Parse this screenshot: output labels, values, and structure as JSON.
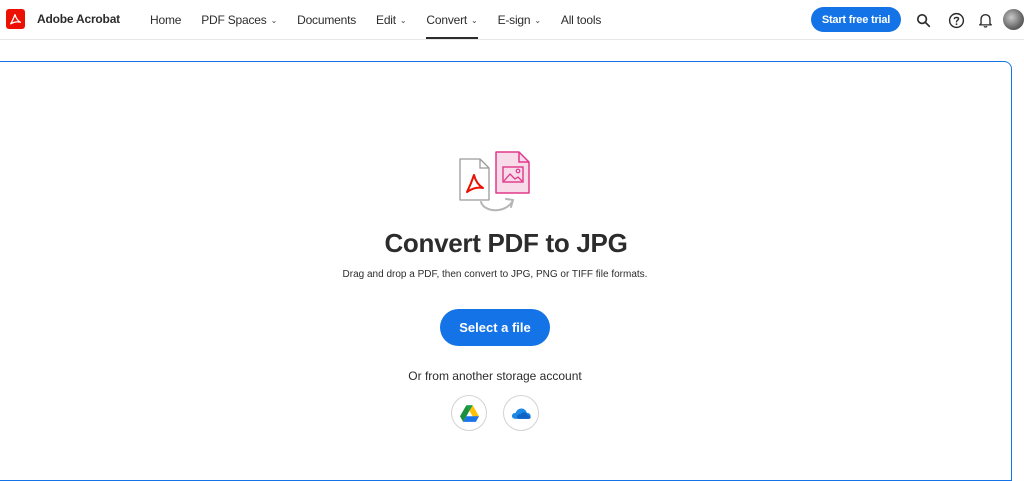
{
  "header": {
    "app_name": "Adobe Acrobat",
    "logo_icon": "adobe-acrobat-logo-icon",
    "nav": [
      {
        "label": "Home",
        "has_menu": false,
        "active": false
      },
      {
        "label": "PDF Spaces",
        "has_menu": true,
        "active": false
      },
      {
        "label": "Documents",
        "has_menu": false,
        "active": false
      },
      {
        "label": "Edit",
        "has_menu": true,
        "active": false
      },
      {
        "label": "Convert",
        "has_menu": true,
        "active": true
      },
      {
        "label": "E-sign",
        "has_menu": true,
        "active": false
      },
      {
        "label": "All tools",
        "has_menu": false,
        "active": false
      }
    ],
    "trial_button": "Start free trial",
    "icons": [
      "search-icon",
      "help-icon",
      "notifications-bell-icon",
      "user-avatar"
    ]
  },
  "main": {
    "illustration_icon": "pdf-to-image-convert-icon",
    "title": "Convert PDF to JPG",
    "subtitle": "Drag and drop a PDF, then convert to JPG, PNG or TIFF file formats.",
    "select_button": "Select a file",
    "storage_label": "Or from another storage account",
    "storage_options": [
      "google-drive-icon",
      "onedrive-icon"
    ]
  },
  "colors": {
    "accent": "#1473e6",
    "brand_red": "#eb1000",
    "image_pink": "#e0388a"
  }
}
